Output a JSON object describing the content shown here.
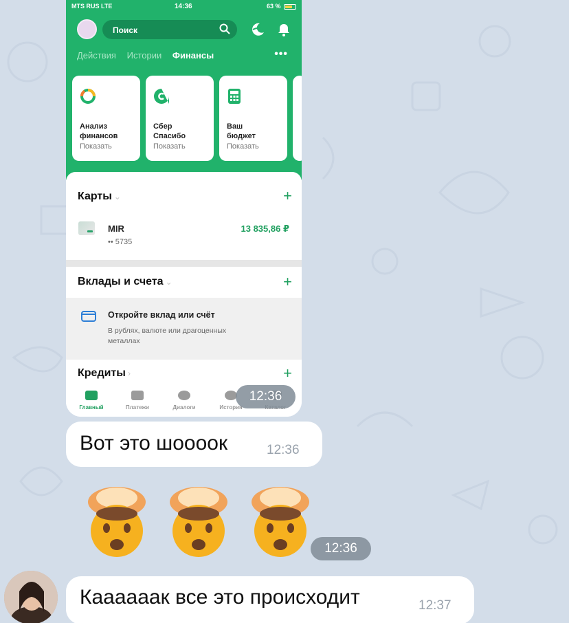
{
  "screenshot": {
    "status": {
      "carrier": "MTS RUS  LTE",
      "time": "14:36",
      "battery": "63 %"
    },
    "search_placeholder": "Поиск",
    "tabs": [
      {
        "label": "Действия",
        "active": false
      },
      {
        "label": "Истории",
        "active": false
      },
      {
        "label": "Финансы",
        "active": true
      }
    ],
    "more_label": "•••",
    "cards": [
      {
        "title1": "Анализ",
        "title2": "финансов",
        "action": "Показать",
        "icon": "analysis-icon"
      },
      {
        "title1": "Сбер",
        "title2": "Спасибо",
        "action": "Показать",
        "icon": "sber-spasibo-icon"
      },
      {
        "title1": "Ваш",
        "title2": "бюджет",
        "action": "Показать",
        "icon": "calculator-icon"
      }
    ],
    "cards_section": {
      "title": "Карты",
      "plus": "+"
    },
    "card_item": {
      "name": "MIR",
      "number": "•• 5735",
      "balance": "13 835,86 ₽"
    },
    "deposits_section": {
      "title": "Вклады и счета",
      "plus": "+"
    },
    "open_deposit": {
      "title": "Откройте вклад или счёт",
      "subtitle1": "В рублях, валюте или драгоценных",
      "subtitle2": "металлах"
    },
    "credits_section": {
      "title": "Кредиты",
      "plus": "+"
    },
    "nav": [
      {
        "label": "Главный",
        "active": true
      },
      {
        "label": "Платежи",
        "active": false
      },
      {
        "label": "Диалоги",
        "active": false
      },
      {
        "label": "История",
        "active": false
      },
      {
        "label": "Каталог",
        "active": false
      }
    ],
    "time_overlay": "12:36"
  },
  "messages": [
    {
      "text": "Вот это шоооок",
      "time": "12:36"
    },
    {
      "emoji_time": "12:36"
    },
    {
      "text": "Кааааaак все это происходит",
      "time": "12:37"
    }
  ],
  "colors": {
    "sber_green": "#21b26b",
    "chat_bg": "#d3dde9"
  }
}
